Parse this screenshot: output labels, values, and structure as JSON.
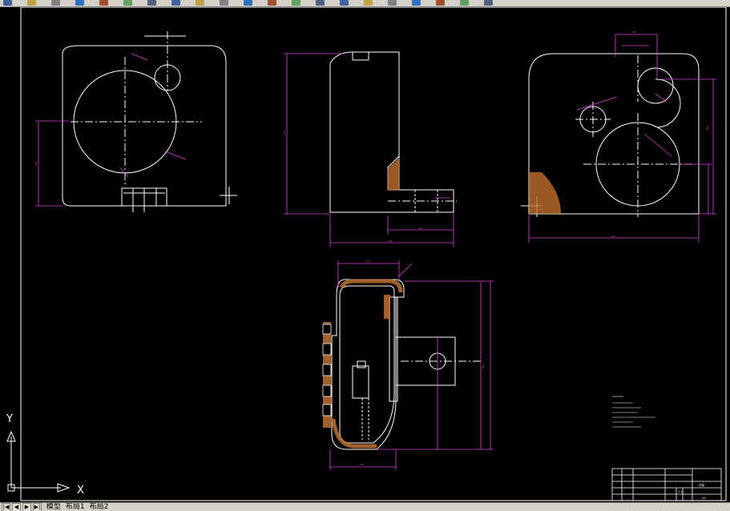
{
  "toolbar": {
    "icons": [
      "open-icon",
      "save-icon",
      "print-icon",
      "preview-icon",
      "publish-icon",
      "cut-icon",
      "copy-icon",
      "paste-icon",
      "match-properties-icon",
      "undo-icon",
      "redo-icon",
      "pan-icon",
      "zoom-realtime-icon",
      "zoom-window-icon",
      "zoom-previous-icon",
      "properties-icon",
      "design-center-icon",
      "tool-palettes-icon",
      "calculator-icon",
      "layer-manager-icon",
      "color-icon"
    ],
    "colors": {
      "bar": "#d4d0c8",
      "magenta": "#e040e0",
      "white": "#ffffff",
      "green": "#00c000",
      "yellow": "#ffff00"
    }
  },
  "ucs": {
    "x_label": "X",
    "y_label": "Y"
  },
  "tabs": {
    "nav": [
      "|◀",
      "◀",
      "▶",
      "▶|"
    ],
    "items": [
      "模型",
      "布局1",
      "布局2"
    ]
  },
  "title_block": {
    "title": "托架",
    "scale": "1:1",
    "sheet": "A3"
  }
}
